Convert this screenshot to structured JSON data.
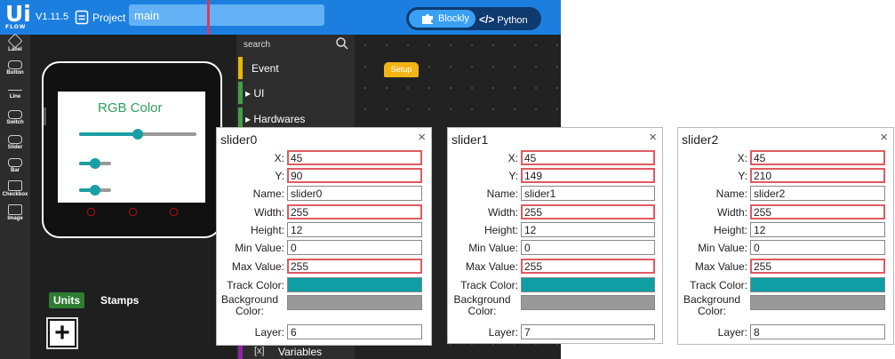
{
  "app": {
    "logo_text": "Ui",
    "logo_sub": "FLOW",
    "version": "V1.11.5",
    "project_label": "Project",
    "project_name": "main",
    "modes": {
      "blockly": "Blockly",
      "python": "Python",
      "python_icon": "</>"
    }
  },
  "rail": [
    {
      "label": "Label",
      "icon": "label-icon"
    },
    {
      "label": "Button",
      "icon": "button-icon"
    },
    {
      "label": "Line",
      "icon": "line-icon"
    },
    {
      "label": "Switch",
      "icon": "switch-icon"
    },
    {
      "label": "Slider",
      "icon": "slider-icon"
    },
    {
      "label": "Bar",
      "icon": "bar-icon"
    },
    {
      "label": "Checkbox",
      "icon": "checkbox-icon"
    },
    {
      "label": "Image",
      "icon": "image-icon"
    }
  ],
  "device": {
    "screen_title": "RGB Color",
    "title_color": "#2ea05a",
    "slider_color": "#1a9ea5",
    "sliders": [
      {
        "name": "slider0",
        "value_fraction": 0.5
      },
      {
        "name": "slider1",
        "value_fraction": 0.5
      },
      {
        "name": "slider2",
        "value_fraction": 0.5
      }
    ]
  },
  "bottom_tabs": {
    "units": "Units",
    "stamps": "Stamps"
  },
  "palette": {
    "search_placeholder": "search",
    "categories": [
      {
        "label": "Event",
        "color": "#e6b800"
      },
      {
        "label": "UI",
        "color": "#43a047"
      },
      {
        "label": "Hardwares",
        "color": "#43a047"
      }
    ],
    "variables_label": "Variables",
    "variables_icon": "[x]"
  },
  "workspace": {
    "setup_block": "Setup"
  },
  "panels": [
    {
      "title": "slider0",
      "x": "45",
      "y": "90",
      "name": "slider0",
      "width": "255",
      "height": "12",
      "min_value": "0",
      "max_value": "255",
      "track_color": "#0e9ea3",
      "background_color": "#999999",
      "layer": "6"
    },
    {
      "title": "slider1",
      "x": "45",
      "y": "149",
      "name": "slider1",
      "width": "255",
      "height": "12",
      "min_value": "0",
      "max_value": "255",
      "track_color": "#0e9ea3",
      "background_color": "#999999",
      "layer": "7"
    },
    {
      "title": "slider2",
      "x": "45",
      "y": "210",
      "name": "slider2",
      "width": "255",
      "height": "12",
      "min_value": "0",
      "max_value": "255",
      "track_color": "#0e9ea3",
      "background_color": "#999999",
      "layer": "8"
    }
  ],
  "labels": {
    "x": "X:",
    "y": "Y:",
    "name": "Name:",
    "width": "Width:",
    "height": "Height:",
    "min_value": "Min Value:",
    "max_value": "Max Value:",
    "track_color": "Track Color:",
    "background_line1": "Background",
    "background_line2": "Color:",
    "layer": "Layer:",
    "close": "×"
  }
}
